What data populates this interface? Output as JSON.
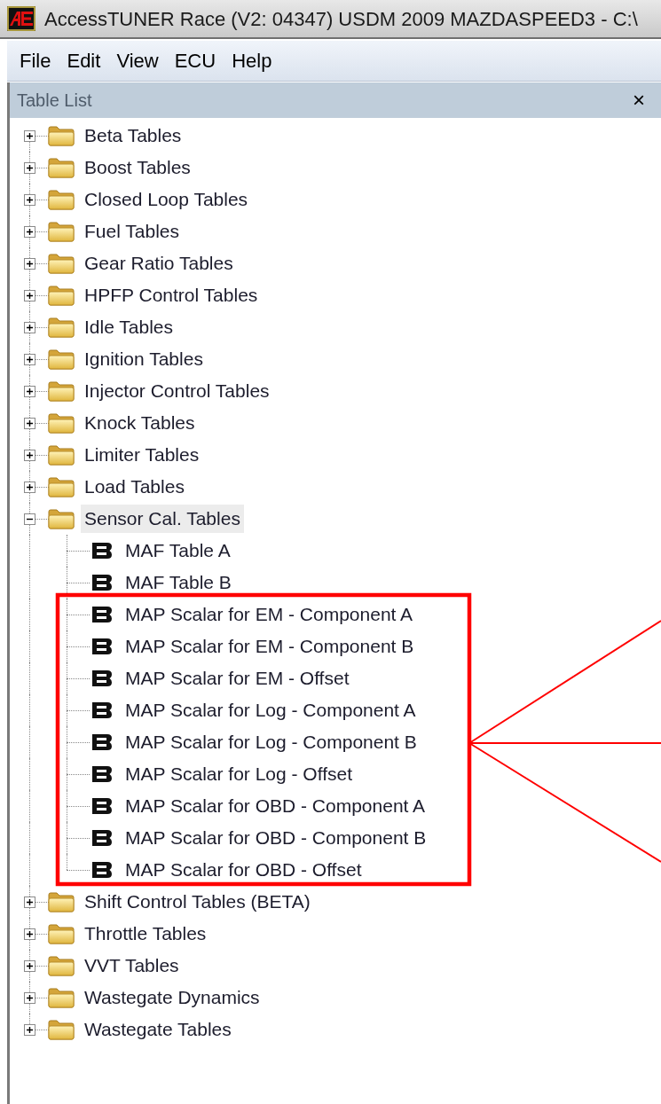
{
  "window": {
    "title": "AccessTUNER Race (V2: 04347) USDM 2009 MAZDASPEED3 - C:\\"
  },
  "menu": [
    "File",
    "Edit",
    "View",
    "ECU",
    "Help"
  ],
  "panel": {
    "title": "Table List",
    "close": "×"
  },
  "tree": [
    {
      "label": "Beta Tables",
      "expanded": false,
      "selected": false
    },
    {
      "label": "Boost Tables",
      "expanded": false,
      "selected": false
    },
    {
      "label": "Closed Loop Tables",
      "expanded": false,
      "selected": false
    },
    {
      "label": "Fuel Tables",
      "expanded": false,
      "selected": false
    },
    {
      "label": "Gear Ratio Tables",
      "expanded": false,
      "selected": false
    },
    {
      "label": "HPFP Control Tables",
      "expanded": false,
      "selected": false
    },
    {
      "label": "Idle Tables",
      "expanded": false,
      "selected": false
    },
    {
      "label": "Ignition Tables",
      "expanded": false,
      "selected": false
    },
    {
      "label": "Injector Control Tables",
      "expanded": false,
      "selected": false
    },
    {
      "label": "Knock Tables",
      "expanded": false,
      "selected": false
    },
    {
      "label": "Limiter Tables",
      "expanded": false,
      "selected": false
    },
    {
      "label": "Load Tables",
      "expanded": false,
      "selected": false
    },
    {
      "label": "Sensor Cal. Tables",
      "expanded": true,
      "selected": true,
      "children": [
        {
          "label": "MAF Table A"
        },
        {
          "label": "MAF Table B"
        },
        {
          "label": "MAP Scalar for EM - Component A"
        },
        {
          "label": "MAP Scalar for EM - Component B"
        },
        {
          "label": "MAP Scalar for EM - Offset"
        },
        {
          "label": "MAP Scalar for Log - Component A"
        },
        {
          "label": "MAP Scalar for Log - Component B"
        },
        {
          "label": "MAP Scalar for Log - Offset"
        },
        {
          "label": "MAP Scalar for OBD - Component A"
        },
        {
          "label": "MAP Scalar for OBD - Component B"
        },
        {
          "label": "MAP Scalar for OBD - Offset"
        }
      ]
    },
    {
      "label": "Shift Control Tables (BETA)",
      "expanded": false,
      "selected": false
    },
    {
      "label": "Throttle Tables",
      "expanded": false,
      "selected": false
    },
    {
      "label": "VVT Tables",
      "expanded": false,
      "selected": false
    },
    {
      "label": "Wastegate Dynamics",
      "expanded": false,
      "selected": false
    },
    {
      "label": "Wastegate Tables",
      "expanded": false,
      "selected": false
    }
  ]
}
